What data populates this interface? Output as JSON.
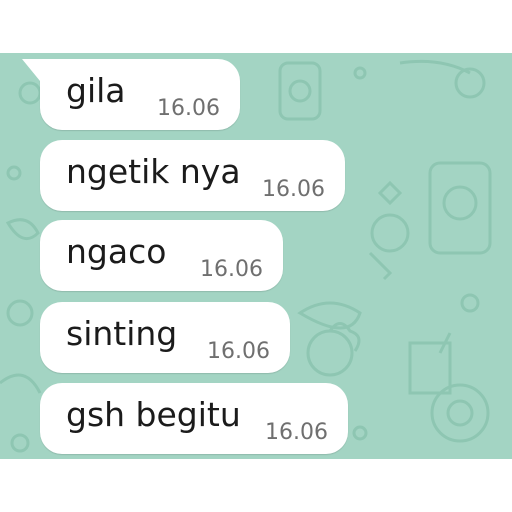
{
  "chat": {
    "background_color": "#a3d4c3",
    "doodle_color": "#8ec6b2",
    "bubble_color": "#ffffff",
    "messages": [
      {
        "text": "gila",
        "time": "16.06"
      },
      {
        "text": "ngetik nya",
        "time": "16.06"
      },
      {
        "text": "ngaco",
        "time": "16.06"
      },
      {
        "text": "sinting",
        "time": "16.06"
      },
      {
        "text": "gsh begitu",
        "time": "16.06"
      }
    ]
  }
}
